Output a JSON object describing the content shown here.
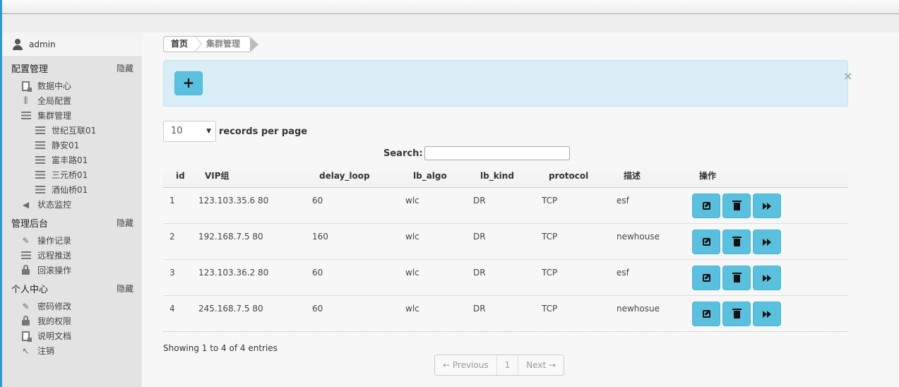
{
  "user": {
    "name": "admin"
  },
  "sidebar": {
    "sections": [
      {
        "title": "配置管理",
        "toggle": "隐藏",
        "items": [
          {
            "label": "数据中心",
            "icon": "document-icon"
          },
          {
            "label": "全局配置",
            "icon": "sliders-icon"
          },
          {
            "label": "集群管理",
            "icon": "list-icon"
          },
          {
            "label": "世纪互联01",
            "icon": "list-icon",
            "sub": true
          },
          {
            "label": "静安01",
            "icon": "list-icon",
            "sub": true
          },
          {
            "label": "富丰路01",
            "icon": "list-icon",
            "sub": true
          },
          {
            "label": "三元桥01",
            "icon": "list-icon",
            "sub": true
          },
          {
            "label": "酒仙桥01",
            "icon": "list-icon",
            "sub": true
          },
          {
            "label": "状态监控",
            "icon": "volume-icon"
          }
        ]
      },
      {
        "title": "管理后台",
        "toggle": "隐藏",
        "items": [
          {
            "label": "操作记录",
            "icon": "pencil-icon"
          },
          {
            "label": "远程推送",
            "icon": "list-icon"
          },
          {
            "label": "回滚操作",
            "icon": "lock-icon"
          }
        ]
      },
      {
        "title": "个人中心",
        "toggle": "隐藏",
        "items": [
          {
            "label": "密码修改",
            "icon": "pencil-icon"
          },
          {
            "label": "我的权限",
            "icon": "lock-icon"
          },
          {
            "label": "说明文档",
            "icon": "document-icon"
          },
          {
            "label": "注销",
            "icon": "logout-arrow-icon"
          }
        ]
      }
    ]
  },
  "breadcrumb": {
    "home": "首页",
    "current": "集群管理"
  },
  "toolbar": {
    "add_label": "+",
    "close_label": "×"
  },
  "table_controls": {
    "page_size": "10",
    "records_per_page_label": "records per page",
    "search_label": "Search:",
    "search_value": ""
  },
  "table": {
    "headers": [
      "id",
      "VIP组",
      "delay_loop",
      "lb_algo",
      "lb_kind",
      "protocol",
      "描述",
      "操作"
    ],
    "rows": [
      {
        "id": "1",
        "vip": "123.103.35.6 80",
        "delay_loop": "60",
        "lb_algo": "wlc",
        "lb_kind": "DR",
        "protocol": "TCP",
        "desc": "esf"
      },
      {
        "id": "2",
        "vip": "192.168.7.5 80",
        "delay_loop": "160",
        "lb_algo": "wlc",
        "lb_kind": "DR",
        "protocol": "TCP",
        "desc": "newhouse"
      },
      {
        "id": "3",
        "vip": "123.103.36.2 80",
        "delay_loop": "60",
        "lb_algo": "wlc",
        "lb_kind": "DR",
        "protocol": "TCP",
        "desc": "esf"
      },
      {
        "id": "4",
        "vip": "245.168.7.5 80",
        "delay_loop": "60",
        "lb_algo": "wlc",
        "lb_kind": "DR",
        "protocol": "TCP",
        "desc": "newhosue"
      }
    ]
  },
  "footer": {
    "info": "Showing 1 to 4 of 4 entries",
    "pager": {
      "previous": "← Previous",
      "page": "1",
      "next": "Next →"
    }
  },
  "colors": {
    "accent": "#5bc0de",
    "alert_bg": "#d9edf7",
    "sidebar_bg": "#e3e3e3",
    "edge": "#2e9ad0"
  }
}
